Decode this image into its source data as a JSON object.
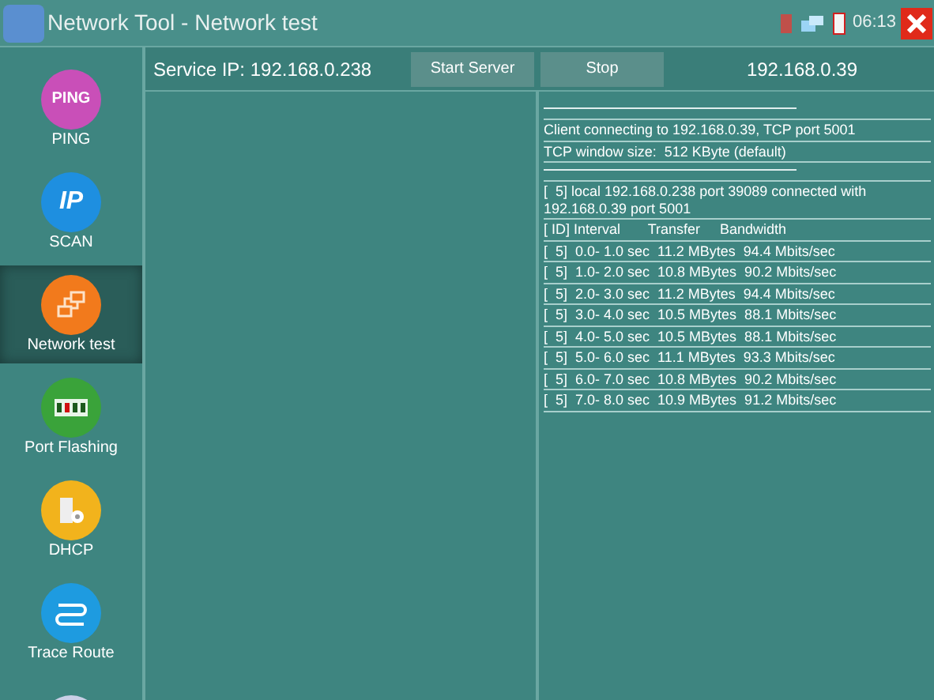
{
  "window": {
    "title": "Network Tool - Network test",
    "time": "06:13"
  },
  "sidebar": {
    "items": [
      {
        "label": "PING",
        "badge": "PING",
        "kind": "ping",
        "selected": false
      },
      {
        "label": "SCAN",
        "badge": "IP",
        "kind": "scan",
        "selected": false
      },
      {
        "label": "Network test",
        "kind": "network",
        "selected": true
      },
      {
        "label": "Port Flashing",
        "kind": "port",
        "selected": false
      },
      {
        "label": "DHCP",
        "kind": "dhcp",
        "selected": false
      },
      {
        "label": "Trace Route",
        "kind": "trace",
        "selected": false
      },
      {
        "kind": "more",
        "selected": false
      }
    ]
  },
  "header": {
    "service_ip": "Service IP: 192.168.0.238",
    "buttons": [
      "Start Server",
      "Stop"
    ],
    "client_ip": "192.168.0.39"
  },
  "log": [
    {
      "kind": "rule"
    },
    {
      "kind": "text",
      "text": "Client connecting to 192.168.0.39, TCP port 5001"
    },
    {
      "kind": "text",
      "text": "TCP window size:  512 KByte (default)"
    },
    {
      "kind": "rule"
    },
    {
      "kind": "text",
      "text": "[  5] local 192.168.0.238 port 39089 connected with 192.168.0.39 port 5001"
    },
    {
      "kind": "text",
      "text": "[ ID] Interval       Transfer     Bandwidth"
    },
    {
      "kind": "text",
      "text": "[  5]  0.0- 1.0 sec  11.2 MBytes  94.4 Mbits/sec"
    },
    {
      "kind": "text",
      "text": "[  5]  1.0- 2.0 sec  10.8 MBytes  90.2 Mbits/sec"
    },
    {
      "kind": "text",
      "text": "[  5]  2.0- 3.0 sec  11.2 MBytes  94.4 Mbits/sec"
    },
    {
      "kind": "text",
      "text": "[  5]  3.0- 4.0 sec  10.5 MBytes  88.1 Mbits/sec"
    },
    {
      "kind": "text",
      "text": "[  5]  4.0- 5.0 sec  10.5 MBytes  88.1 Mbits/sec"
    },
    {
      "kind": "text",
      "text": "[  5]  5.0- 6.0 sec  11.1 MBytes  93.3 Mbits/sec"
    },
    {
      "kind": "text",
      "text": "[  5]  6.0- 7.0 sec  10.8 MBytes  90.2 Mbits/sec"
    },
    {
      "kind": "text",
      "text": "[  5]  7.0- 8.0 sec  10.9 MBytes  91.2 Mbits/sec"
    }
  ]
}
